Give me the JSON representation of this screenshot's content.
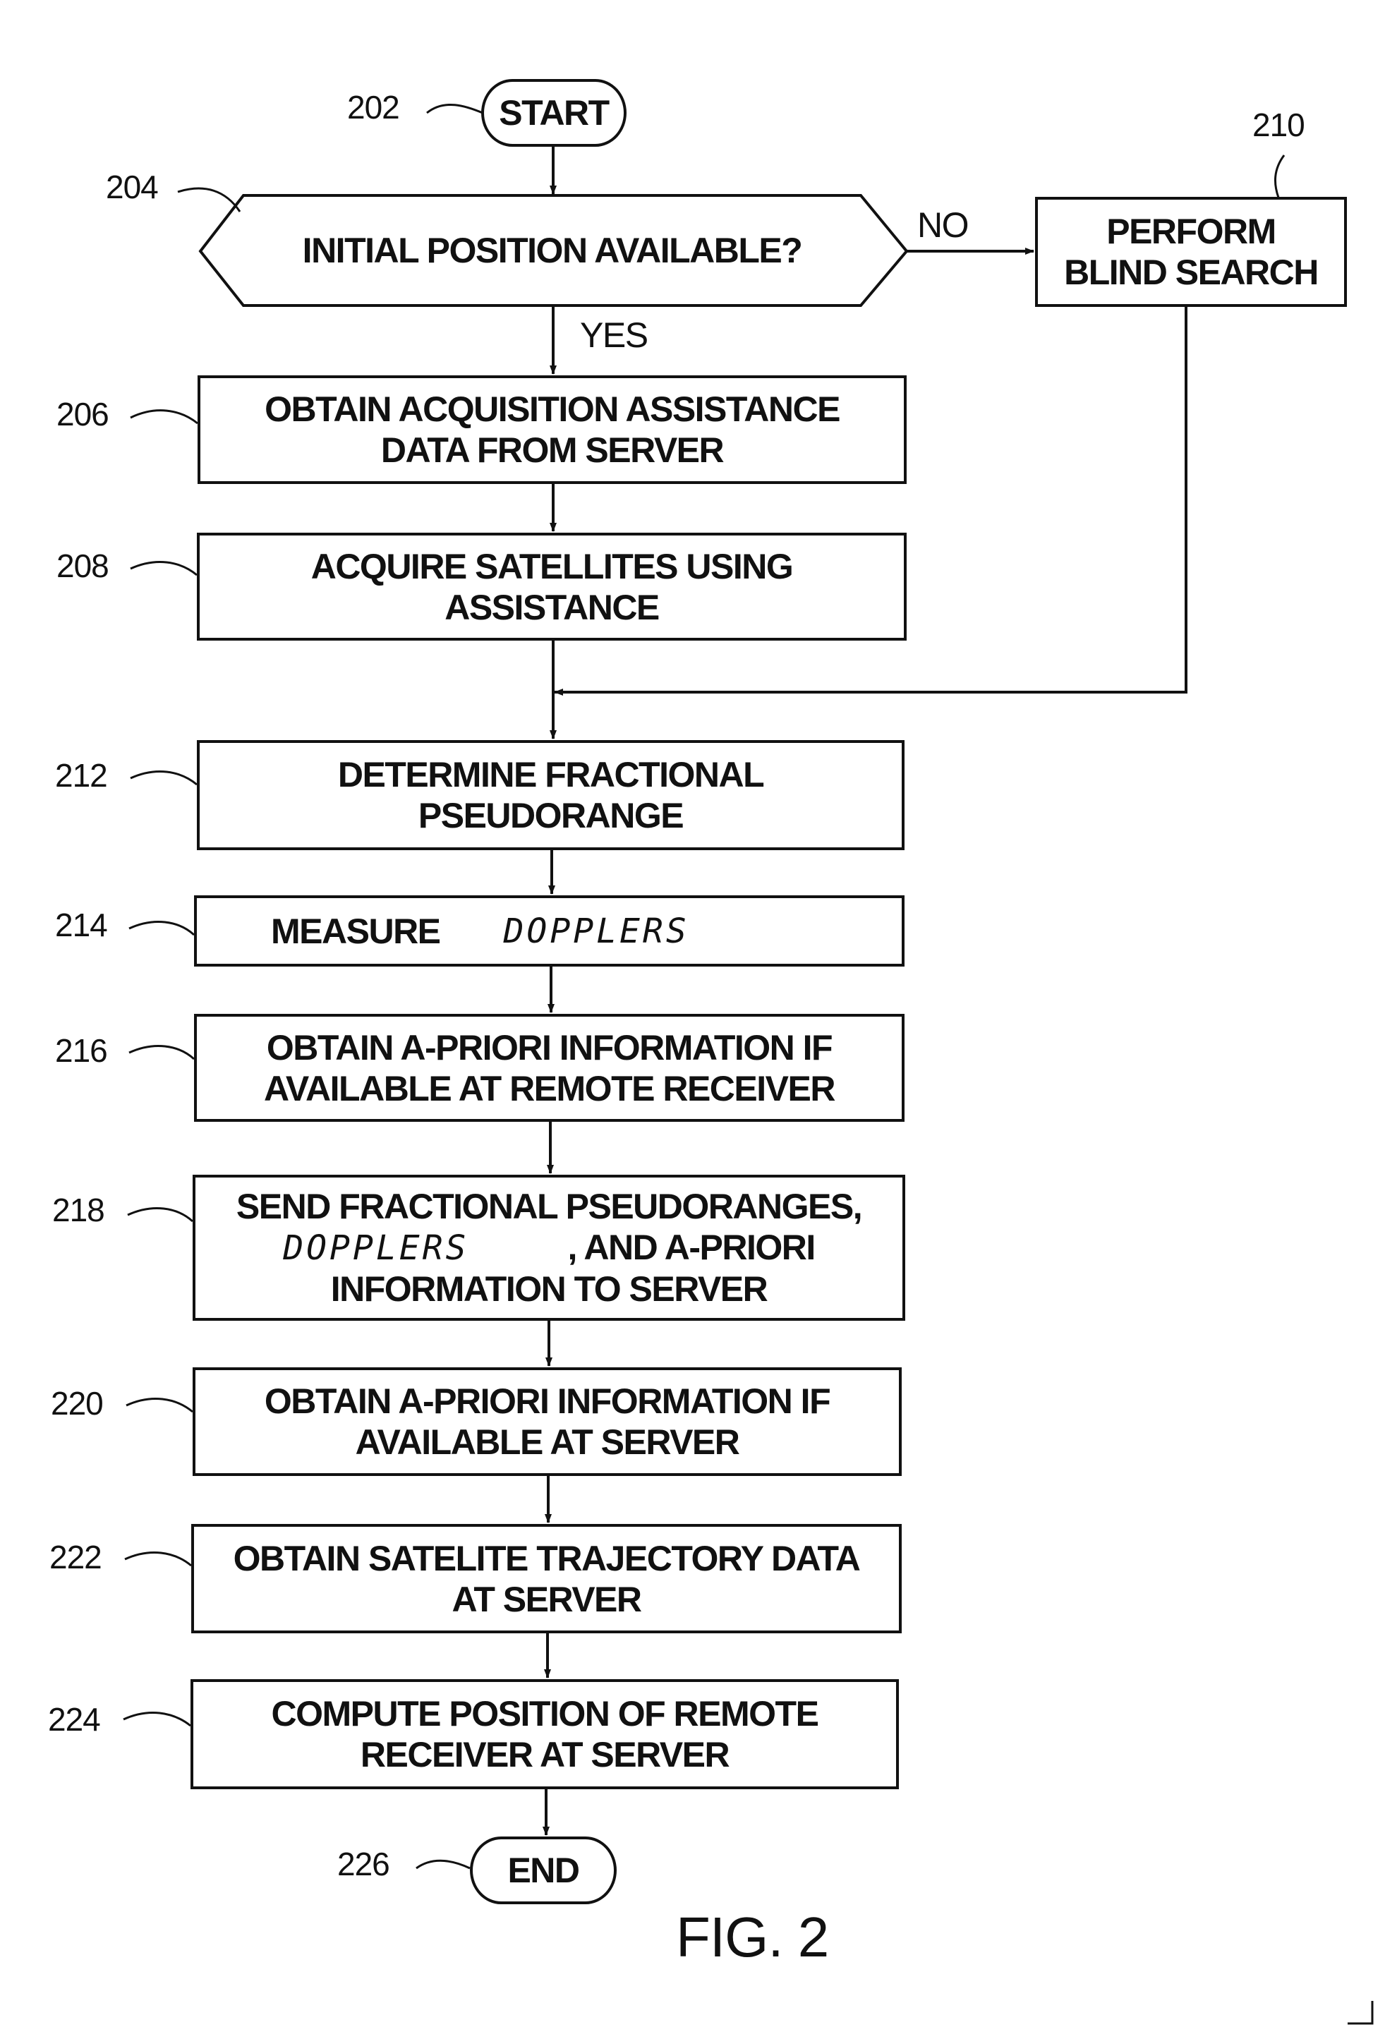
{
  "figure": {
    "caption": "FIG. 2"
  },
  "nodes": {
    "start": {
      "ref": "202",
      "text": "START"
    },
    "decision": {
      "ref": "204",
      "text": "INITIAL POSITION AVAILABLE?",
      "yes_label": "YES",
      "no_label": "NO"
    },
    "blind_search": {
      "ref": "210",
      "line1": "PERFORM",
      "line2": "BLIND SEARCH"
    },
    "obtain_assistance": {
      "ref": "206",
      "line1": "OBTAIN ACQUISITION ASSISTANCE",
      "line2": "DATA FROM SERVER"
    },
    "acquire_satellites": {
      "ref": "208",
      "line1": "ACQUIRE SATELLITES USING",
      "line2": "ASSISTANCE"
    },
    "fractional_pseudorange": {
      "ref": "212",
      "line1": "DETERMINE FRACTIONAL",
      "line2": "PSEUDORANGE"
    },
    "measure": {
      "ref": "214",
      "text": "MEASURE",
      "handwritten": "DOPPLERS"
    },
    "apriori_receiver": {
      "ref": "216",
      "line1": "OBTAIN A-PRIORI INFORMATION IF",
      "line2": "AVAILABLE AT REMOTE RECEIVER"
    },
    "send_to_server": {
      "ref": "218",
      "line1": "SEND FRACTIONAL PSEUDORANGES,",
      "handwritten": "DOPPLERS",
      "line2_rest": ", AND A-PRIORI",
      "line3": "INFORMATION TO SERVER"
    },
    "apriori_server": {
      "ref": "220",
      "line1": "OBTAIN A-PRIORI INFORMATION IF",
      "line2": "AVAILABLE AT SERVER"
    },
    "trajectory": {
      "ref": "222",
      "line1": "OBTAIN SATELITE TRAJECTORY DATA",
      "line2": "AT SERVER"
    },
    "compute_position": {
      "ref": "224",
      "line1": "COMPUTE POSITION OF REMOTE",
      "line2": "RECEIVER AT SERVER"
    },
    "end": {
      "ref": "226",
      "text": "END"
    }
  }
}
